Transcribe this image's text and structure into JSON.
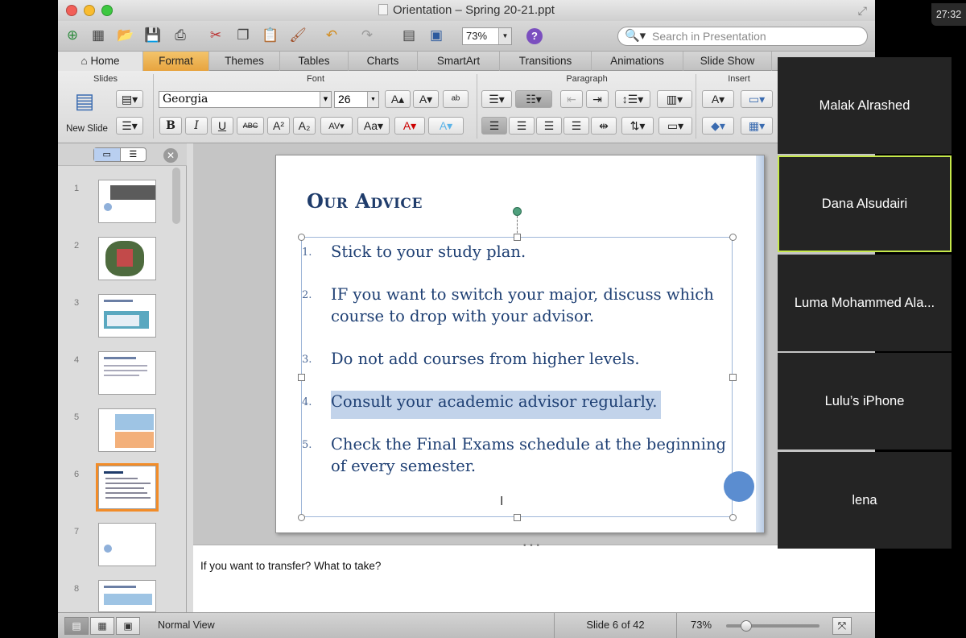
{
  "window": {
    "title": "Orientation – Spring 20-21.ppt",
    "zoom": "73%",
    "search_placeholder": "Search in Presentation"
  },
  "ribbon_tabs": [
    {
      "label": "Home",
      "icon": "home-icon"
    },
    {
      "label": "Format"
    },
    {
      "label": "Themes"
    },
    {
      "label": "Tables"
    },
    {
      "label": "Charts"
    },
    {
      "label": "SmartArt"
    },
    {
      "label": "Transitions"
    },
    {
      "label": "Animations"
    },
    {
      "label": "Slide Show"
    }
  ],
  "ribbon": {
    "groups": {
      "slides": "Slides",
      "font": "Font",
      "paragraph": "Paragraph",
      "insert": "Insert"
    },
    "new_slide": "New Slide",
    "font_name": "Georgia",
    "font_size": "26"
  },
  "thumbnails": [
    "1",
    "2",
    "3",
    "4",
    "5",
    "6",
    "7",
    "8"
  ],
  "slide": {
    "title": "Our Advice",
    "items": [
      {
        "num": "1.",
        "text": "Stick to your study plan."
      },
      {
        "num": "2.",
        "text": "IF you want to switch your major, discuss which course to drop with your advisor."
      },
      {
        "num": "3.",
        "text": "Do not add courses from higher levels."
      },
      {
        "num": "4.",
        "text": "Consult your academic advisor regularly."
      },
      {
        "num": "5.",
        "text": "Check the Final Exams schedule at the beginning of every semester."
      }
    ]
  },
  "notes": "If you want to transfer? What to take?",
  "status": {
    "view": "Normal View",
    "slide_count": "Slide 6 of 42",
    "zoom": "73%",
    "zoom_level": 0.18
  },
  "participants": [
    {
      "name": "Malak Alrashed",
      "speaking": false
    },
    {
      "name": "Dana Alsudairi",
      "speaking": true
    },
    {
      "name": "Luma Mohammed Ala...",
      "speaking": false
    },
    {
      "name": "Lulu’s iPhone",
      "speaking": false
    },
    {
      "name": "lena",
      "speaking": false
    }
  ],
  "clock": "27:32",
  "colors": {
    "accent_tab": "#e7a43f",
    "speaker_border": "#c6e94b",
    "slide_text": "#1e3f73"
  }
}
